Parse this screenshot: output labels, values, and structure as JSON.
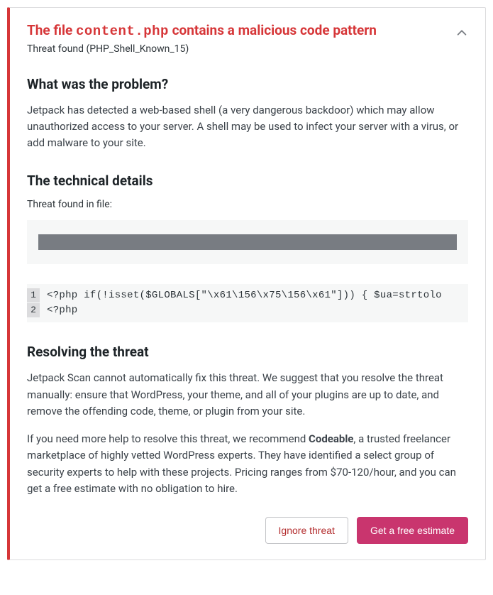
{
  "header": {
    "title_prefix": "The file ",
    "title_filename": "content.php",
    "title_suffix": " contains a malicious code pattern",
    "subtitle": "Threat found (PHP_Shell_Known_15)"
  },
  "problem": {
    "heading": "What was the problem?",
    "body": "Jetpack has detected a web-based shell (a very dangerous backdoor) which may allow unauthorized access to your server. A shell may be used to infect your server with a virus, or add malware to your site."
  },
  "technical": {
    "heading": "The technical details",
    "found_in_label": "Threat found in file:",
    "code_lines": [
      {
        "n": "1",
        "text": "<?php if(!isset($GLOBALS[\"\\x61\\156\\x75\\156\\x61\"])) { $ua=strtolo"
      },
      {
        "n": "2",
        "text": "<?php"
      }
    ]
  },
  "resolving": {
    "heading": "Resolving the threat",
    "body1": "Jetpack Scan cannot automatically fix this threat. We suggest that you resolve the threat manually: ensure that WordPress, your theme, and all of your plugins are up to date, and remove the offending code, theme, or plugin from your site.",
    "body2_pre": "If you need more help to resolve this threat, we recommend ",
    "body2_bold": "Codeable",
    "body2_post": ", a trusted freelancer marketplace of highly vetted WordPress experts. They have identified a select group of security experts to help with these projects. Pricing ranges from $70-120/hour, and you can get a free estimate with no obligation to hire."
  },
  "buttons": {
    "ignore": "Ignore threat",
    "estimate": "Get a free estimate"
  }
}
